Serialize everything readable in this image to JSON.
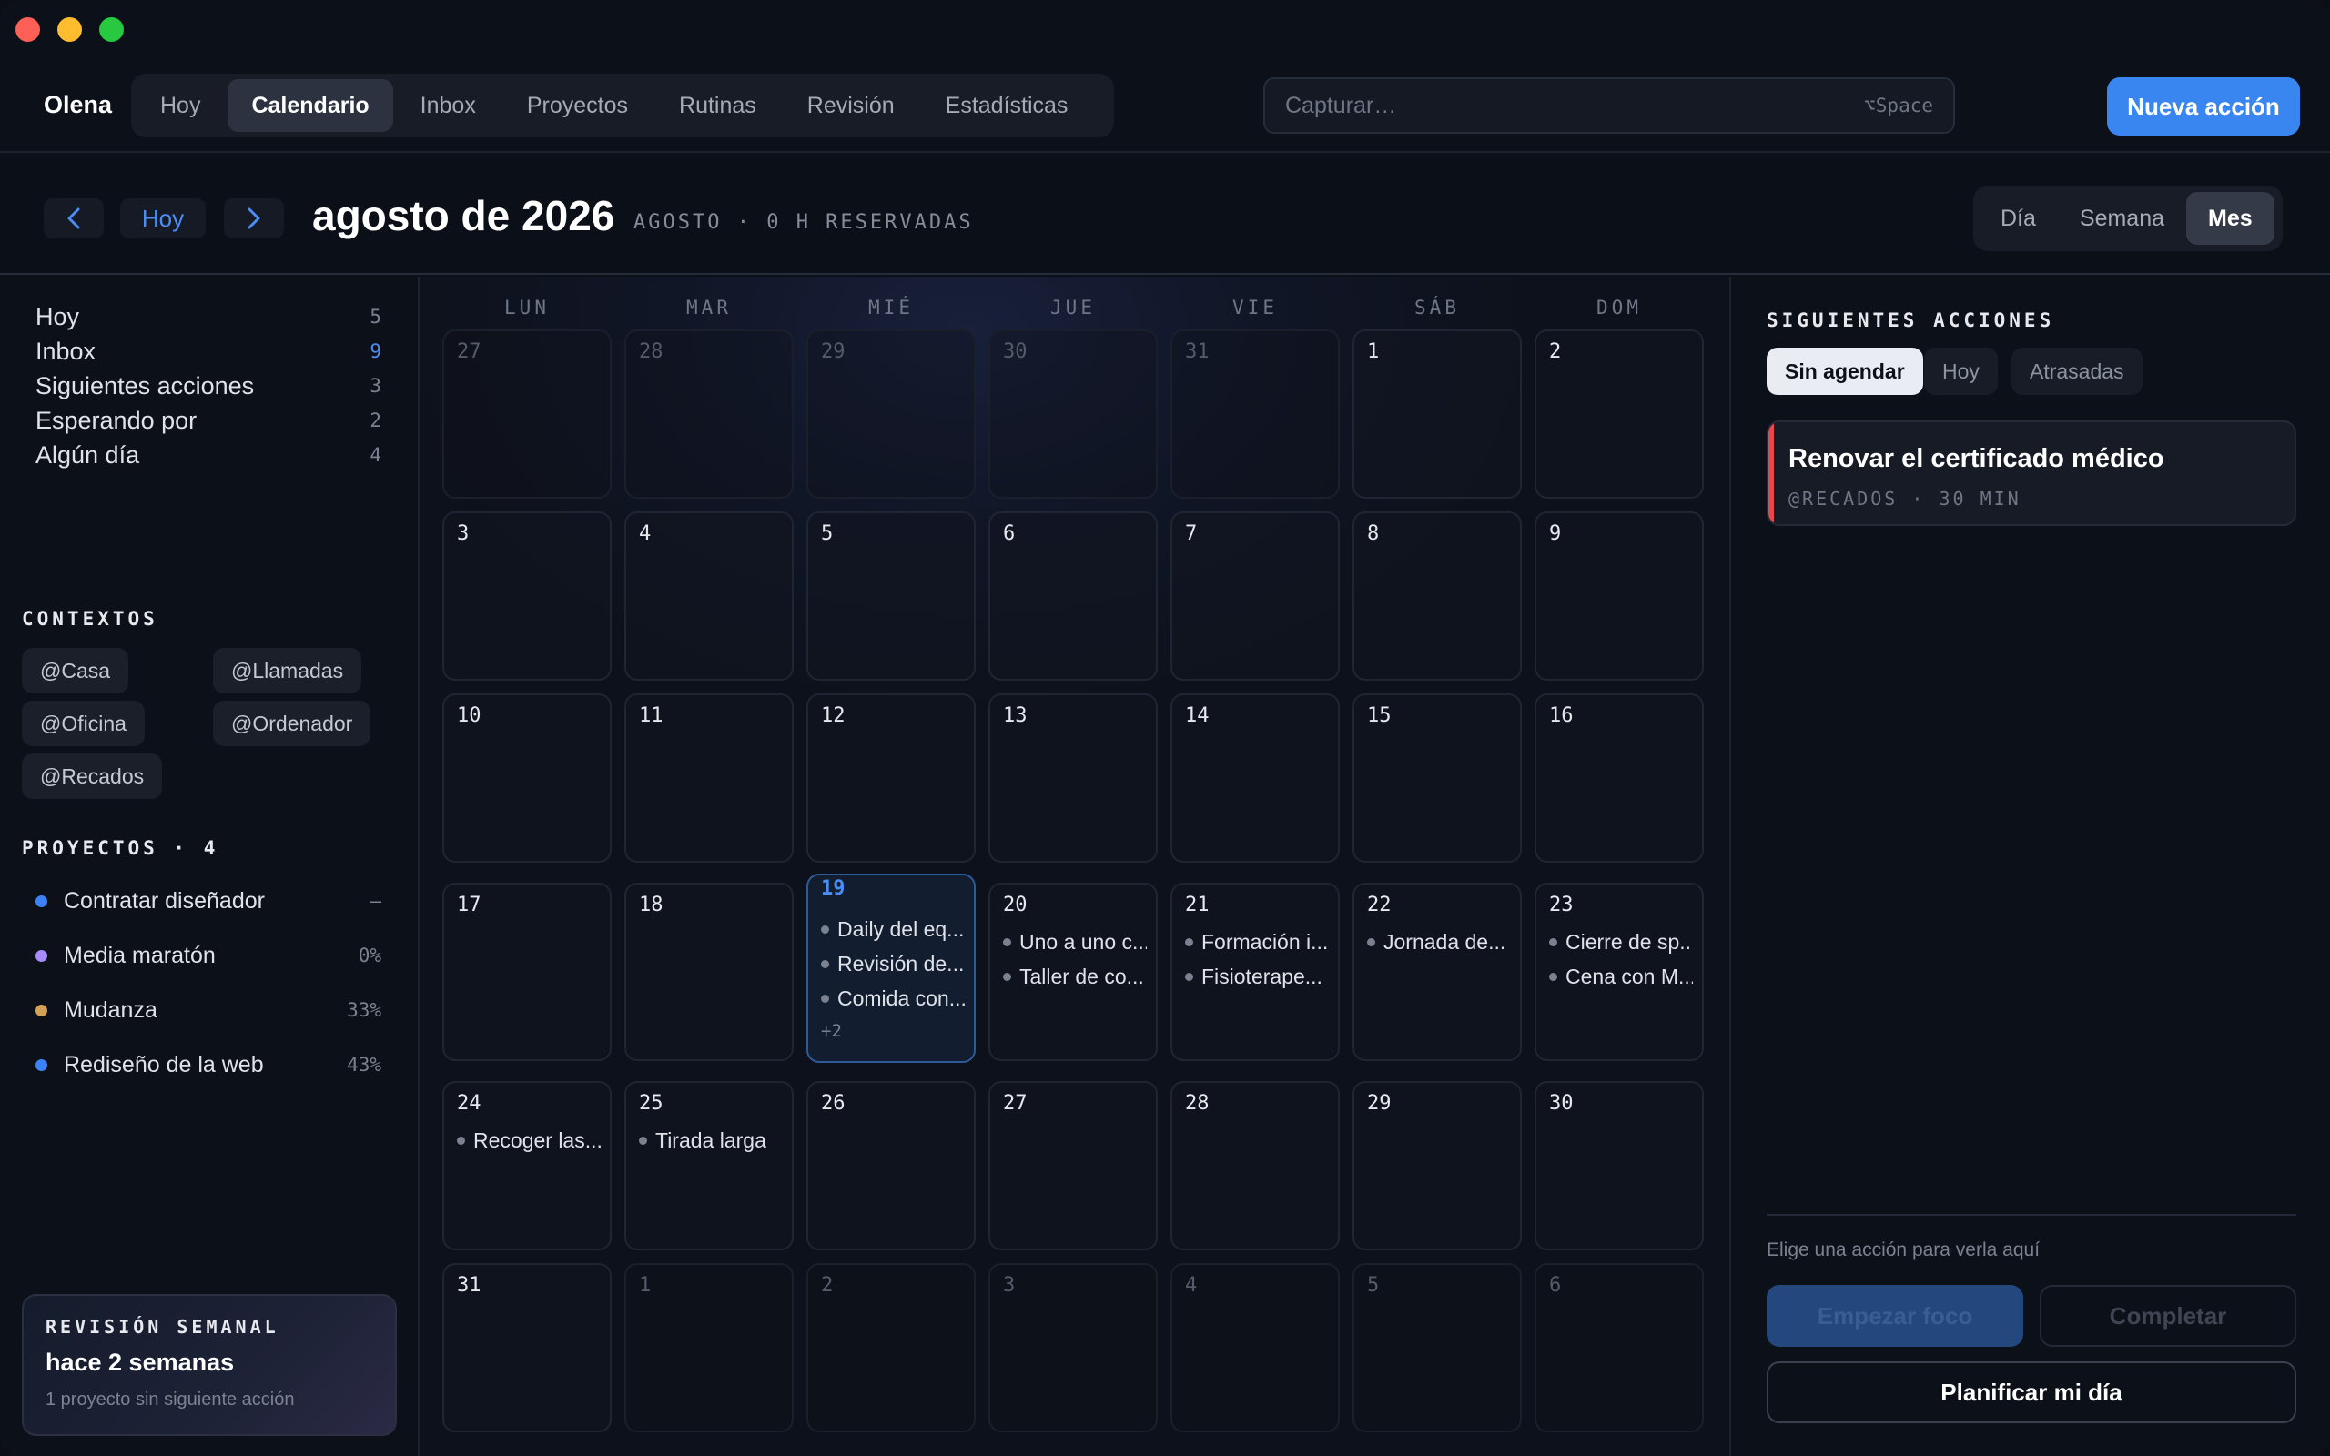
{
  "window": {
    "traffic_lights": [
      "close",
      "minimize",
      "zoom"
    ]
  },
  "topbar": {
    "user": "Olena",
    "nav": [
      "Hoy",
      "Calendario",
      "Inbox",
      "Proyectos",
      "Rutinas",
      "Revisión",
      "Estadísticas"
    ],
    "active_nav": "Calendario",
    "capture_placeholder": "Capturar…",
    "capture_shortcut": "⌥Space",
    "new_action_label": "Nueva acción"
  },
  "subheader": {
    "prev_icon": "chevron-left-icon",
    "today_label": "Hoy",
    "next_icon": "chevron-right-icon",
    "title": "agosto de 2026",
    "subtitle": "AGOSTO · 0 H RESERVADAS",
    "views": [
      "Día",
      "Semana",
      "Mes"
    ],
    "active_view": "Mes"
  },
  "sidebar": {
    "lists": [
      {
        "label": "Hoy",
        "count": "5"
      },
      {
        "label": "Inbox",
        "count": "9",
        "highlight": true
      },
      {
        "label": "Siguientes acciones",
        "count": "3"
      },
      {
        "label": "Esperando por",
        "count": "2"
      },
      {
        "label": "Algún día",
        "count": "4"
      }
    ],
    "contexts_title": "CONTEXTOS",
    "contexts": [
      "@Casa",
      "@Llamadas",
      "@Oficina",
      "@Ordenador",
      "@Recados"
    ],
    "projects_title": "PROYECTOS · 4",
    "projects": [
      {
        "name": "Contratar diseñador",
        "progress": "–",
        "color": "#3b82f6"
      },
      {
        "name": "Media maratón",
        "progress": "0%",
        "color": "#a78bfa"
      },
      {
        "name": "Mudanza",
        "progress": "33%",
        "color": "#d4a056"
      },
      {
        "name": "Rediseño de la web",
        "progress": "43%",
        "color": "#3b82f6"
      }
    ],
    "review": {
      "label": "REVISIÓN SEMANAL",
      "title": "hace 2 semanas",
      "subtitle": "1 proyecto sin siguiente acción"
    }
  },
  "calendar": {
    "weekdays": [
      "LUN",
      "MAR",
      "MIÉ",
      "JUE",
      "VIE",
      "SÁB",
      "DOM"
    ],
    "weeks": [
      [
        {
          "n": "27",
          "other": true
        },
        {
          "n": "28",
          "other": true
        },
        {
          "n": "29",
          "other": true
        },
        {
          "n": "30",
          "other": true
        },
        {
          "n": "31",
          "other": true
        },
        {
          "n": "1"
        },
        {
          "n": "2"
        }
      ],
      [
        {
          "n": "3"
        },
        {
          "n": "4"
        },
        {
          "n": "5"
        },
        {
          "n": "6"
        },
        {
          "n": "7"
        },
        {
          "n": "8"
        },
        {
          "n": "9"
        }
      ],
      [
        {
          "n": "10"
        },
        {
          "n": "11"
        },
        {
          "n": "12"
        },
        {
          "n": "13"
        },
        {
          "n": "14"
        },
        {
          "n": "15"
        },
        {
          "n": "16"
        }
      ],
      [
        {
          "n": "17"
        },
        {
          "n": "18"
        },
        {
          "n": "19",
          "today": true,
          "events": [
            "Daily del eq...",
            "Revisión de...",
            "Comida con..."
          ],
          "more": "+2"
        },
        {
          "n": "20",
          "events": [
            "Uno a uno c...",
            "Taller de co..."
          ]
        },
        {
          "n": "21",
          "events": [
            "Formación i...",
            "Fisioterape..."
          ]
        },
        {
          "n": "22",
          "events": [
            "Jornada de..."
          ]
        },
        {
          "n": "23",
          "events": [
            "Cierre de sp...",
            "Cena con M..."
          ]
        }
      ],
      [
        {
          "n": "24",
          "events": [
            "Recoger las..."
          ]
        },
        {
          "n": "25",
          "events": [
            "Tirada larga"
          ]
        },
        {
          "n": "26"
        },
        {
          "n": "27"
        },
        {
          "n": "28"
        },
        {
          "n": "29"
        },
        {
          "n": "30"
        }
      ],
      [
        {
          "n": "31"
        },
        {
          "n": "1",
          "other": true
        },
        {
          "n": "2",
          "other": true
        },
        {
          "n": "3",
          "other": true
        },
        {
          "n": "4",
          "other": true
        },
        {
          "n": "5",
          "other": true
        },
        {
          "n": "6",
          "other": true
        }
      ]
    ]
  },
  "rightpanel": {
    "title": "SIGUIENTES ACCIONES",
    "tabs": [
      "Sin agendar",
      "Hoy",
      "Atrasadas"
    ],
    "active_tab": "Sin agendar",
    "task": {
      "title": "Renovar el certificado médico",
      "meta": "@RECADOS · 30 MIN",
      "accent": "#e5484d"
    },
    "hint": "Elige una acción para verla aquí",
    "focus_label": "Empezar foco",
    "complete_label": "Completar",
    "plan_label": "Planificar mi día"
  }
}
